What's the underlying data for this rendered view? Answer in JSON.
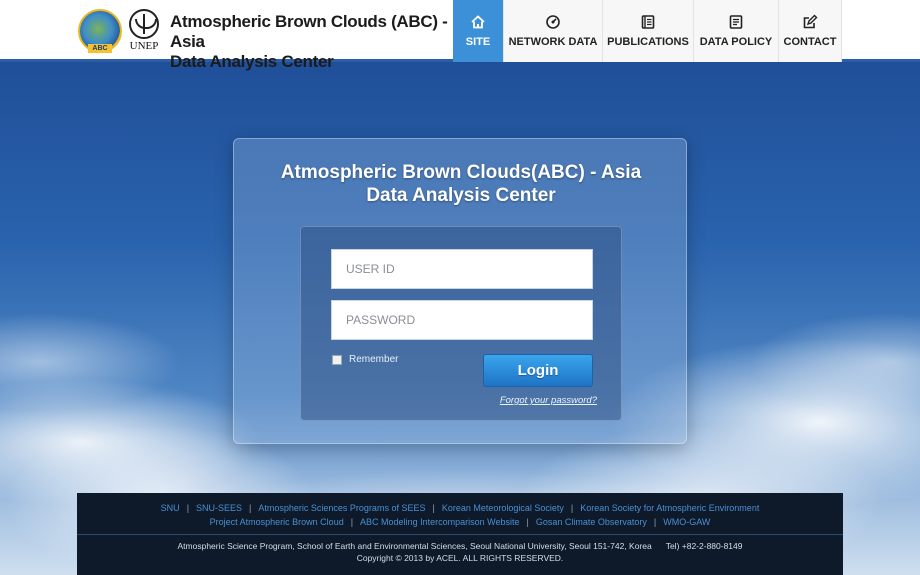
{
  "header": {
    "logo_abc_text": "ATMOSPHERIC BROWN CLOUDS",
    "logo_abc_tag": "ABC",
    "logo_unep_text": "UNEP",
    "site_title_line1": "Atmospheric Brown Clouds (ABC) - Asia",
    "site_title_line2": "Data Analysis Center"
  },
  "nav": {
    "items": [
      {
        "label": "SITE",
        "icon": "home-icon",
        "active": true
      },
      {
        "label": "NETWORK DATA",
        "icon": "network-icon"
      },
      {
        "label": "PUBLICATIONS",
        "icon": "book-icon"
      },
      {
        "label": "DATA POLICY",
        "icon": "document-icon"
      },
      {
        "label": "CONTACT",
        "icon": "edit-icon"
      }
    ]
  },
  "login": {
    "title_line1": "Atmospheric Brown Clouds(ABC) - Asia",
    "title_line2": "Data Analysis Center",
    "user_placeholder": "USER ID",
    "password_placeholder": "PASSWORD",
    "remember_label": "Remember",
    "login_button": "Login",
    "forgot_link": "Forgot your password?"
  },
  "footer": {
    "links_row1": [
      "SNU",
      "SNU-SEES",
      "Atmospheric Sciences Programs of SEES",
      "Korean Meteorological Society",
      "Korean Society for Atmospheric Environment"
    ],
    "links_row2": [
      "Project Atmospheric Brown Cloud",
      "ABC Modeling Intercomparison Website",
      "Gosan Climate Observatory",
      "WMO-GAW"
    ],
    "address": "Atmospheric Science Program, School of Earth and Environmental Sciences, Seoul National University, Seoul 151-742, Korea",
    "tel": "Tel) +82-2-880-8149",
    "copyright": "Copyright © 2013 by ACEL. ALL RIGHTS RESERVED."
  },
  "colors": {
    "accent": "#3c90d8",
    "header_border": "#2b5ea6",
    "footer_bg": "#0e1a2a",
    "footer_link": "#4a8fd2"
  }
}
